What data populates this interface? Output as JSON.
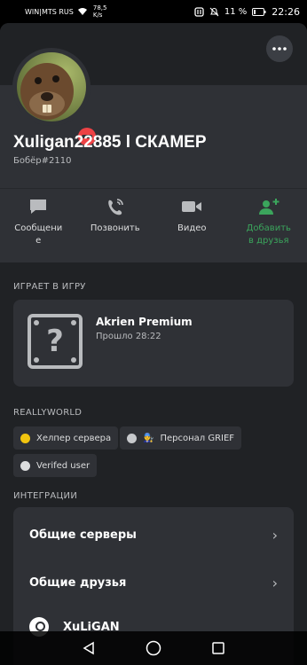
{
  "status": {
    "carrier": "WIN|MTS RUS",
    "speed_value": "78,5",
    "speed_unit": "K/s",
    "battery": "11 %",
    "time": "22:26"
  },
  "profile": {
    "username": "Xuligan22885 l СКАМЕР",
    "tag": "Бобёр#2110",
    "status": "do-not-disturb",
    "more_icon": "more-icon"
  },
  "actions": [
    {
      "label": "Сообщени\nе",
      "icon": "message-icon"
    },
    {
      "label": "Позвонить",
      "icon": "call-icon"
    },
    {
      "label": "Видео",
      "icon": "video-icon"
    },
    {
      "label": "Добавить\nв друзья",
      "icon": "add-friend-icon",
      "color": "#3ba55c"
    }
  ],
  "activity": {
    "section_title": "ИГРАЕТ В ИГРУ",
    "game_name": "Akrien Premium",
    "elapsed": "Прошло 28:22",
    "icon": "unknown-game-icon"
  },
  "server_roles": {
    "section_title": "REALLYWORLD",
    "roles": [
      {
        "label": "Хелпер сервера",
        "color": "#f1c40f",
        "emoji": ""
      },
      {
        "label": "Персонал GRIEF",
        "color": "#c7c9cc",
        "emoji": "👨‍🔧"
      },
      {
        "label": "Verifed user",
        "color": "#dcddde",
        "emoji": ""
      }
    ]
  },
  "integrations": {
    "section_title": "ИНТЕГРАЦИИ",
    "common_servers": "Общие серверы",
    "common_friends": "Общие друзья",
    "steam_account": "XuLiGAN"
  },
  "colors": {
    "background": "#2f3136",
    "banner": "#202225",
    "accent_green": "#3ba55c",
    "dnd_red": "#ed4245"
  }
}
